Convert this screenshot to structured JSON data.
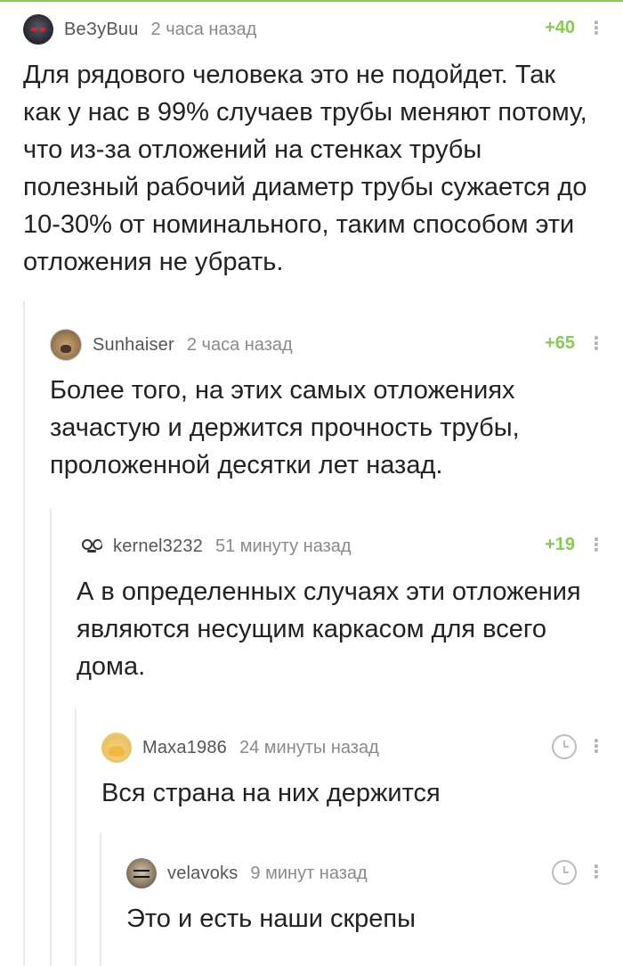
{
  "comments": [
    {
      "author": "BeЗyBuu",
      "time": "2 часа назад",
      "rating": "+40",
      "avatar_icon": "anime-avatar",
      "text": "Для рядового человека это не подойдет. Так как у нас в 99% случаев трубы меняют потому, что из-за отложений на стенках трубы полезный рабочий диаметр трубы сужается до 10-30% от номинального, таким способом эти отложения не убрать."
    },
    {
      "author": "Sunhaiser",
      "time": "2 часа назад",
      "rating": "+65",
      "avatar_icon": "dog-avatar",
      "text": "Более того, на этих самых отложениях зачастую и держится прочность трубы, проложенной десятки лет назад."
    },
    {
      "author": "kernel3232",
      "time": "51 минуту назад",
      "rating": "+19",
      "avatar_icon": "glasses-face-avatar",
      "text": "А в определенных случаях эти отложения являются несущим каркасом для всего дома."
    },
    {
      "author": "Maxa1986",
      "time": "24 минуты назад",
      "rating_icon": "clock-icon",
      "avatar_icon": "emoji-avatar",
      "text": "Вся страна на них держится"
    },
    {
      "author": "velavoks",
      "time": "9 минут назад",
      "rating_icon": "clock-icon",
      "avatar_icon": "bald-man-avatar",
      "text": "Это и есть наши скрепы"
    }
  ],
  "more_label": "⋮",
  "colors": {
    "accent": "#8ac858",
    "author": "#555555",
    "time": "#8a8a8a",
    "thread_line": "#e9e9e9"
  }
}
